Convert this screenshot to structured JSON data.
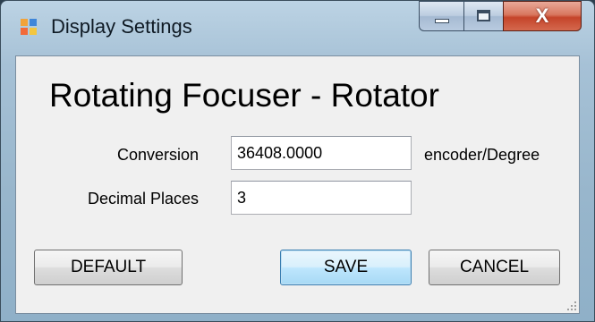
{
  "window": {
    "title": "Display Settings",
    "app_icon": "windows-form-icon",
    "caption_buttons": {
      "minimize_icon": "minimize-icon",
      "maximize_icon": "maximize-icon",
      "close_icon": "close-icon",
      "close_glyph": "X"
    }
  },
  "form": {
    "heading": "Rotating Focuser - Rotator",
    "fields": {
      "conversion": {
        "label": "Conversion",
        "value": "36408.0000",
        "unit": "encoder/Degree"
      },
      "decimal_places": {
        "label": "Decimal Places",
        "value": "3"
      }
    },
    "buttons": {
      "default": "DEFAULT",
      "save": "SAVE",
      "cancel": "CANCEL"
    }
  },
  "colors": {
    "title_bar": "#a6c1d6",
    "client_bg": "#f0f0f0",
    "close_button": "#c5442a",
    "focused_button_border": "#3c7fb1"
  }
}
